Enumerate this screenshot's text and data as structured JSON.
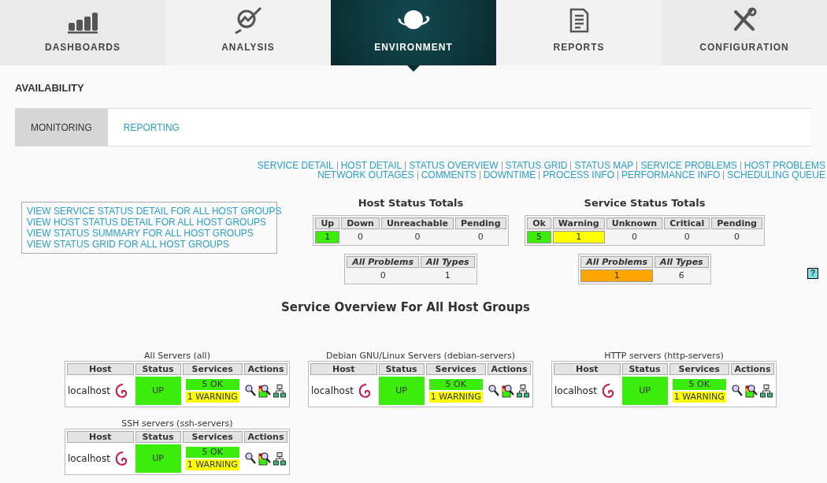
{
  "nav_tabs": [
    {
      "kind": "dashboards",
      "label": "DASHBOARDS",
      "selected": false
    },
    {
      "kind": "analysis",
      "label": "ANALYSIS",
      "selected": false
    },
    {
      "kind": "environment",
      "label": "ENVIRONMENT",
      "selected": true
    },
    {
      "kind": "reports",
      "label": "REPORTS",
      "selected": false
    },
    {
      "kind": "configuration",
      "label": "CONFIGURATION",
      "selected": false
    }
  ],
  "page_title": "AVAILABILITY",
  "sub_tabs": [
    {
      "label": "MONITORING",
      "selected": true
    },
    {
      "label": "REPORTING",
      "selected": false
    }
  ],
  "quick_links": [
    [
      "SERVICE DETAIL",
      "HOST DETAIL",
      "STATUS OVERVIEW",
      "STATUS GRID",
      "STATUS MAP",
      "SERVICE PROBLEMS",
      "HOST PROBLEMS"
    ],
    [
      "NETWORK OUTAGES",
      "COMMENTS",
      "DOWNTIME",
      "PROCESS INFO",
      "PERFORMANCE INFO",
      "SCHEDULING QUEUE"
    ]
  ],
  "view_links": [
    "VIEW SERVICE STATUS DETAIL FOR ALL HOST GROUPS",
    "VIEW HOST STATUS DETAIL FOR ALL HOST GROUPS",
    "VIEW STATUS SUMMARY FOR ALL HOST GROUPS",
    "VIEW STATUS GRID FOR ALL HOST GROUPS"
  ],
  "host_totals": {
    "title": "Host Status Totals",
    "columns": [
      {
        "label": "Up",
        "value": "1",
        "color": "#3cec0c"
      },
      {
        "label": "Down",
        "value": "0"
      },
      {
        "label": "Unreachable",
        "value": "0"
      },
      {
        "label": "Pending",
        "value": "0"
      }
    ],
    "summary": [
      {
        "label": "All Problems",
        "value": "0"
      },
      {
        "label": "All Types",
        "value": "1"
      }
    ]
  },
  "service_totals": {
    "title": "Service Status Totals",
    "columns": [
      {
        "label": "Ok",
        "value": "5",
        "color": "#3cec0c"
      },
      {
        "label": "Warning",
        "value": "1",
        "color": "#ffff00"
      },
      {
        "label": "Unknown",
        "value": "0"
      },
      {
        "label": "Critical",
        "value": "0"
      },
      {
        "label": "Pending",
        "value": "0"
      }
    ],
    "summary": [
      {
        "label": "All Problems",
        "value": "1",
        "color": "#ffa500"
      },
      {
        "label": "All Types",
        "value": "6"
      }
    ]
  },
  "help_button": "?",
  "overview_title": "Service Overview For All Host Groups",
  "groups": [
    {
      "title": "All Servers (all)",
      "columns": [
        "Host",
        "Status",
        "Services",
        "Actions"
      ],
      "rows": [
        {
          "host": "localhost",
          "status": "UP",
          "services": [
            {
              "label": "5 OK",
              "color": "#3cec0c"
            },
            {
              "label": "1 WARNING",
              "color": "#ffff00"
            }
          ]
        }
      ]
    },
    {
      "title": "Debian GNU/Linux Servers (debian-servers)",
      "columns": [
        "Host",
        "Status",
        "Services",
        "Actions"
      ],
      "rows": [
        {
          "host": "localhost",
          "status": "UP",
          "services": [
            {
              "label": "5 OK",
              "color": "#3cec0c"
            },
            {
              "label": "1 WARNING",
              "color": "#ffff00"
            }
          ]
        }
      ]
    },
    {
      "title": "HTTP servers (http-servers)",
      "columns": [
        "Host",
        "Status",
        "Services",
        "Actions"
      ],
      "rows": [
        {
          "host": "localhost",
          "status": "UP",
          "services": [
            {
              "label": "5 OK",
              "color": "#3cec0c"
            },
            {
              "label": "1 WARNING",
              "color": "#ffff00"
            }
          ]
        }
      ]
    },
    {
      "title": "SSH servers (ssh-servers)",
      "columns": [
        "Host",
        "Status",
        "Services",
        "Actions"
      ],
      "rows": [
        {
          "host": "localhost",
          "status": "UP",
          "services": [
            {
              "label": "5 OK",
              "color": "#3cec0c"
            },
            {
              "label": "1 WARNING",
              "color": "#ffff00"
            }
          ]
        }
      ]
    }
  ]
}
